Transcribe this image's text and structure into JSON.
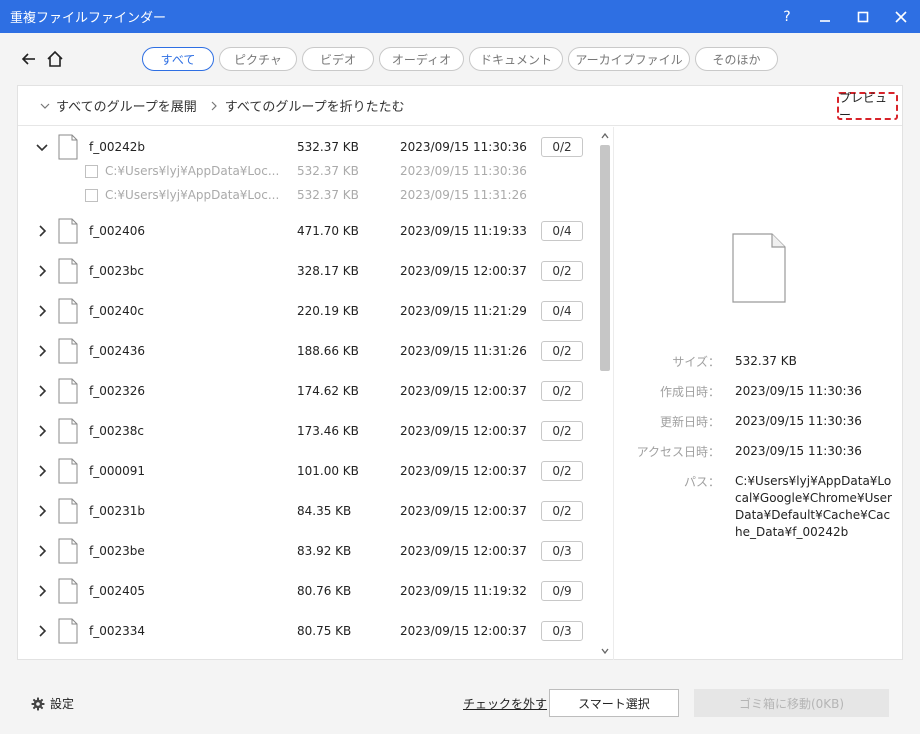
{
  "window": {
    "title": "重複ファイルファインダー",
    "help": "?",
    "accent": "#2e6fe3"
  },
  "tabs": [
    {
      "label": "すべて",
      "active": true
    },
    {
      "label": "ピクチャ",
      "active": false
    },
    {
      "label": "ビデオ",
      "active": false
    },
    {
      "label": "オーディオ",
      "active": false
    },
    {
      "label": "ドキュメント",
      "active": false
    },
    {
      "label": "アーカイブファイル",
      "active": false
    },
    {
      "label": "そのほか",
      "active": false
    }
  ],
  "toolbar": {
    "expand_all": "すべてのグループを展開",
    "collapse_all": "すべてのグループを折りたたむ",
    "preview": "プレビュー"
  },
  "groups": [
    {
      "name": "f_00242b",
      "size": "532.37 KB",
      "date": "2023/09/15 11:30:36",
      "count": "0/2",
      "expanded": true,
      "files": [
        {
          "path": "C:¥Users¥lyj¥AppData¥Loc...",
          "size": "532.37 KB",
          "date": "2023/09/15 11:30:36"
        },
        {
          "path": "C:¥Users¥lyj¥AppData¥Loc...",
          "size": "532.37 KB",
          "date": "2023/09/15 11:31:26"
        }
      ]
    },
    {
      "name": "f_002406",
      "size": "471.70 KB",
      "date": "2023/09/15 11:19:33",
      "count": "0/4",
      "expanded": false
    },
    {
      "name": "f_0023bc",
      "size": "328.17 KB",
      "date": "2023/09/15 12:00:37",
      "count": "0/2",
      "expanded": false
    },
    {
      "name": "f_00240c",
      "size": "220.19 KB",
      "date": "2023/09/15 11:21:29",
      "count": "0/4",
      "expanded": false
    },
    {
      "name": "f_002436",
      "size": "188.66 KB",
      "date": "2023/09/15 11:31:26",
      "count": "0/2",
      "expanded": false
    },
    {
      "name": "f_002326",
      "size": "174.62 KB",
      "date": "2023/09/15 12:00:37",
      "count": "0/2",
      "expanded": false
    },
    {
      "name": "f_00238c",
      "size": "173.46 KB",
      "date": "2023/09/15 12:00:37",
      "count": "0/2",
      "expanded": false
    },
    {
      "name": "f_000091",
      "size": "101.00 KB",
      "date": "2023/09/15 12:00:37",
      "count": "0/2",
      "expanded": false
    },
    {
      "name": "f_00231b",
      "size": "84.35 KB",
      "date": "2023/09/15 12:00:37",
      "count": "0/2",
      "expanded": false
    },
    {
      "name": "f_0023be",
      "size": "83.92 KB",
      "date": "2023/09/15 12:00:37",
      "count": "0/3",
      "expanded": false
    },
    {
      "name": "f_002405",
      "size": "80.76 KB",
      "date": "2023/09/15 11:19:32",
      "count": "0/9",
      "expanded": false
    },
    {
      "name": "f_002334",
      "size": "80.75 KB",
      "date": "2023/09/15 12:00:37",
      "count": "0/3",
      "expanded": false
    }
  ],
  "preview": {
    "rows": [
      {
        "label": "サイズ：",
        "value": "532.37 KB"
      },
      {
        "label": "作成日時：",
        "value": "2023/09/15 11:30:36"
      },
      {
        "label": "更新日時：",
        "value": "2023/09/15 11:30:36"
      },
      {
        "label": "アクセス日時：",
        "value": "2023/09/15 11:30:36"
      },
      {
        "label": "パス：",
        "value": "C:¥Users¥lyj¥AppData¥Local¥Google¥Chrome¥User Data¥Default¥Cache¥Cache_Data¥f_00242b"
      }
    ]
  },
  "footer": {
    "settings": "設定",
    "uncheck": "チェックを外す",
    "smart_select": "スマート選択",
    "move_to_trash": "ゴミ箱に移動(0KB)"
  }
}
